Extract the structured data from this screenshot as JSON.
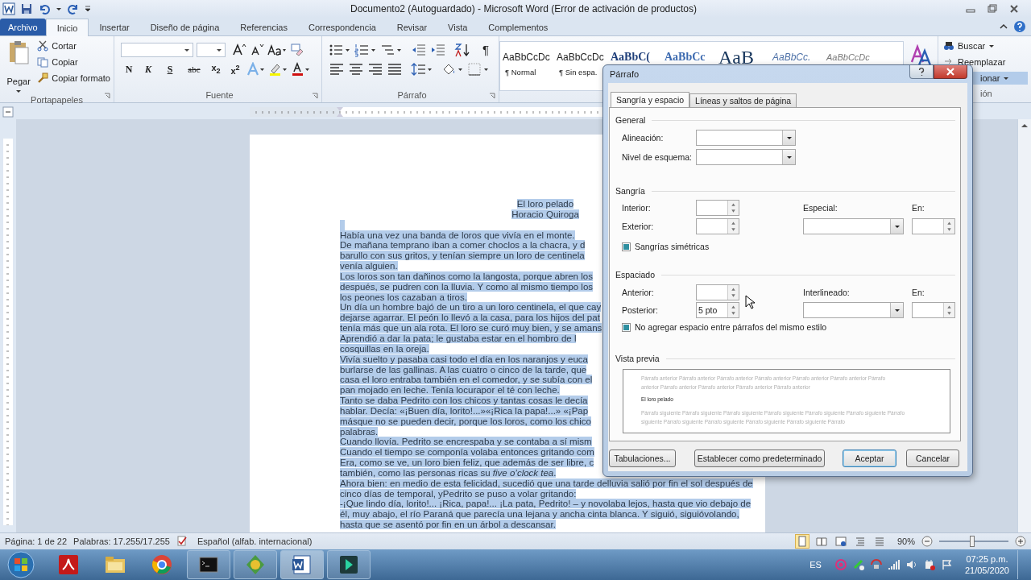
{
  "window": {
    "title": "Documento2 (Autoguardado)  -  Microsoft Word (Error de activación de productos)"
  },
  "ribbon_tabs": [
    {
      "label": "Archivo",
      "kind": "file",
      "selected": false
    },
    {
      "label": "Inicio",
      "kind": "tab",
      "selected": true
    },
    {
      "label": "Insertar",
      "kind": "tab",
      "selected": false
    },
    {
      "label": "Diseño de página",
      "kind": "tab",
      "selected": false
    },
    {
      "label": "Referencias",
      "kind": "tab",
      "selected": false
    },
    {
      "label": "Correspondencia",
      "kind": "tab",
      "selected": false
    },
    {
      "label": "Revisar",
      "kind": "tab",
      "selected": false
    },
    {
      "label": "Vista",
      "kind": "tab",
      "selected": false
    },
    {
      "label": "Complementos",
      "kind": "tab",
      "selected": false
    }
  ],
  "clipboard": {
    "paste": "Pegar",
    "items": [
      "Cortar",
      "Copiar",
      "Copiar formato"
    ],
    "group": "Portapapeles"
  },
  "font": {
    "format_buttons": [
      "N",
      "K",
      "S",
      "abc",
      "x$_{2}$",
      "x$^{2}$"
    ],
    "group": "Fuente"
  },
  "paragraph": {
    "marks": "¶",
    "group": "Párrafo"
  },
  "styles": [
    {
      "sample": "AaBbCcDc",
      "name": "¶ Normal",
      "kind": "normal"
    },
    {
      "sample": "AaBbCcDc",
      "name": "¶ Sin espa.",
      "kind": "normal"
    },
    {
      "sample": "AaBbC(",
      "kind": "heading1"
    },
    {
      "sample": "AaBbCc",
      "kind": "heading2"
    },
    {
      "sample": "AaB",
      "kind": "title"
    },
    {
      "sample": "AaBbCc.",
      "kind": "subtitle"
    },
    {
      "sample": "AaBbCcDc",
      "kind": "emphasis"
    }
  ],
  "editing": {
    "find": "Buscar",
    "replace": "Reemplazar",
    "select": "ionar",
    "group": "ión"
  },
  "document": {
    "selected": true,
    "title_lines": [
      "El loro pelado",
      "Horacio Quiroga"
    ],
    "lines": [
      "Había una vez una banda de loros que vivía en el monte.",
      "De mañana temprano iban a comer choclos a la chacra, y d",
      "barullo con sus gritos, y tenían siempre un loro de centinela",
      "venía alguien.",
      "Los loros son tan dañinos como la langosta, porque abren los",
      "después, se pudren con la lluvia. Y como al mismo tiempo los",
      "los peones los cazaban a tiros.",
      "Un día un hombre bajó de un tiro a un loro centinela, el que cay",
      "dejarse agarrar. El peón lo llevó a la casa, para los hijos del pat",
      "tenía más que un ala rota. El loro se curó muy bien, y se amans",
      "Aprendió a dar la pata; le gustaba estar en el hombro de l",
      "cosquillas en la oreja.",
      "Vivía suelto y pasaba casi todo el día en los naranjos y euca",
      "burlarse de las gallinas. A las cuatro o cinco de la tarde, que",
      "casa el loro entraba también en el comedor, y se subía con el",
      "pan mojado en leche. Tenía locurapor el té con leche.",
      "Tanto se daba Pedrito con los chicos y tantas cosas le decía",
      "hablar. Decía: «¡Buen día, lorito!...»«¡Rica la papa!...» «¡Pap",
      "másque no se pueden decir, porque los loros, como los chico",
      "palabras.",
      "Cuando llovía. Pedrito se encrespaba y se contaba a sí mism",
      "Cuando el tiempo se componía volaba entonces gritando com",
      "Era, como se ve, un loro bien feliz, que además de ser libre, c",
      "también, como las personas ricas su *five o’clock tea*.",
      "Ahora bien: en medio de esta felicidad, sucedió que una tarde delluvia salió por fin el sol después de",
      "cinco días de temporal, yPedrito se puso a volar gritando:",
      "-¡Que lindo día, lorito!... ¡Rica, papa!... ¡La pata, Pedrito! – y novolaba lejos, hasta que vio debajo de",
      "él, muy abajo, el río Paraná que parecía una lejana y ancha cinta blanca. Y siguió, siguióvolando,",
      "hasta que se asentó por fin en un árbol a descansar."
    ]
  },
  "dialog": {
    "title": "Párrafo",
    "tabs": [
      {
        "label": "Sangría y espacio",
        "selected": true
      },
      {
        "label": "Líneas y saltos de página",
        "selected": false
      }
    ],
    "general": {
      "legend": "General",
      "alignment": "Alineación:",
      "outline": "Nivel de esquema:"
    },
    "indent": {
      "legend": "Sangría",
      "inner": "Interior:",
      "outer": "Exterior:",
      "special": "Especial:",
      "by": "En:",
      "mirror": {
        "label": "Sangrías simétricas",
        "indeterminate": true
      }
    },
    "spacing": {
      "legend": "Espaciado",
      "before": "Anterior:",
      "after": "Posterior:",
      "after_value": "5 pto",
      "line": "Interlineado:",
      "by": "En:",
      "no_space": {
        "label": "No agregar espacio entre párrafos del mismo estilo",
        "indeterminate": true
      }
    },
    "preview": {
      "legend": "Vista previa",
      "before": [
        "Párrafo anterior Párrafo anterior Párrafo anterior Párrafo anterior Párrafo anterior Párrafo anterior Párrafo",
        "anterior Párrafo anterior Párrafo anterior Párrafo anterior Párrafo anterior"
      ],
      "sample": "El loro pelado",
      "after": [
        "Párrafo siguiente Párrafo siguiente Párrafo siguiente Párrafo siguiente Párrafo siguiente Párrafo siguiente Párrafo",
        "siguiente Párrafo siguiente Párrafo siguiente Párrafo siguiente Párrafo siguiente Párrafo"
      ]
    },
    "buttons": [
      {
        "label": "Tabulaciones...",
        "kind": "plain"
      },
      {
        "label": "Establecer como predeterminado",
        "kind": "plain"
      },
      {
        "label": "Aceptar",
        "kind": "default"
      },
      {
        "label": "Cancelar",
        "kind": "plain"
      }
    ]
  },
  "status_bar": {
    "page": "Página: 1 de 22",
    "words": "Palabras: 17.255/17.255",
    "language": "Español (alfab. internacional)",
    "zoom": "90%",
    "level": 0.48
  },
  "taskbar": {
    "language": "ES",
    "time": "07:25 p.m.",
    "date": "21/05/2020"
  }
}
